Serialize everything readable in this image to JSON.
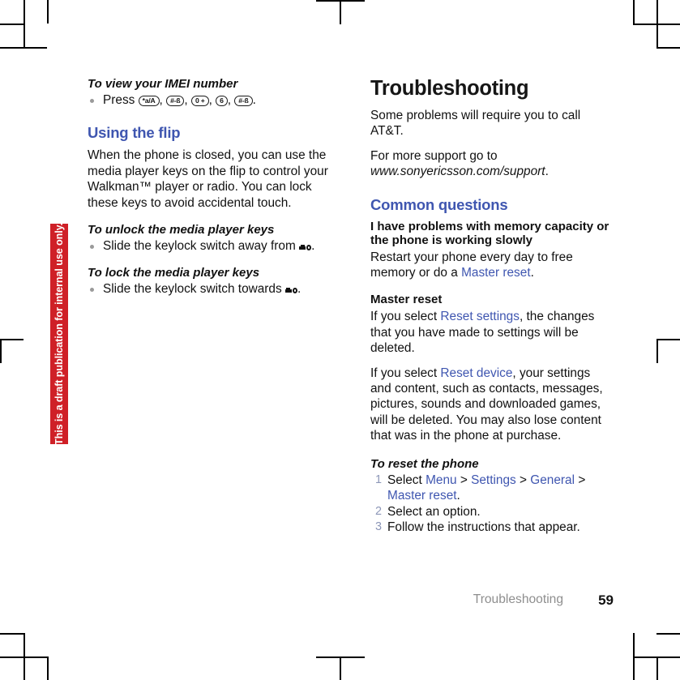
{
  "document": {
    "draft_notice": "This is a draft publication for internal use only."
  },
  "left_column": {
    "imei_heading": "To view your IMEI number",
    "imei_bullet": {
      "lead": "Press ",
      "keys": [
        "*a/A",
        "#-ß",
        "0 +",
        "6",
        "#-ß"
      ],
      "trailing": "."
    },
    "flip_heading": "Using the flip",
    "flip_paragraph": "When the phone is closed, you can use the media player keys on the flip to control your Walkman™ player or radio. You can lock these keys to avoid accidental touch.",
    "unlock_heading": "To unlock the media player keys",
    "unlock_bullet_before": "Slide the keylock switch away from ",
    "unlock_bullet_after": ".",
    "lock_heading": "To lock the media player keys",
    "lock_bullet_before": "Slide the keylock switch towards ",
    "lock_bullet_after": "."
  },
  "right_column": {
    "title": "Troubleshooting",
    "intro_paragraph": "Some problems will require you to call AT&T.",
    "support_lead": "For more support go to ",
    "support_url": "www.sonyericsson.com/support",
    "support_trailing": ".",
    "common_questions_heading": "Common questions",
    "memory_question": "I have problems with memory capacity or the phone is working slowly",
    "memory_answer_before": "Restart your phone every day to free memory or do a ",
    "memory_answer_link": "Master reset",
    "memory_answer_after": ".",
    "master_reset_heading": "Master reset",
    "reset_settings_before": "If you select ",
    "reset_settings_link": "Reset settings",
    "reset_settings_after": ", the changes that you have made to settings will be deleted.",
    "reset_device_before": "If you select ",
    "reset_device_link": "Reset device",
    "reset_device_after": ", your settings and content, such as contacts, messages, pictures, sounds and downloaded games, will be deleted. You may also lose content that was in the phone at purchase.",
    "to_reset_heading": "To reset the phone",
    "steps": [
      {
        "number": "1",
        "before": "Select ",
        "link1": "Menu",
        "sep1": " > ",
        "link2": "Settings",
        "sep2": " > ",
        "link3": "General",
        "sep3": " > ",
        "link4": "Master reset",
        "after": "."
      },
      {
        "number": "2",
        "text": "Select an option."
      },
      {
        "number": "3",
        "text": "Follow the instructions that appear."
      }
    ]
  },
  "footer": {
    "chapter": "Troubleshooting",
    "page_number": "59"
  },
  "colors": {
    "link_blue": "#3f56b0",
    "heading_blue": "#3f56b0",
    "draft_red": "#cf2027",
    "step_number_gray": "#8d97b8",
    "footer_gray": "#8e8e8e",
    "bullet_gray": "#9a9a9a"
  }
}
